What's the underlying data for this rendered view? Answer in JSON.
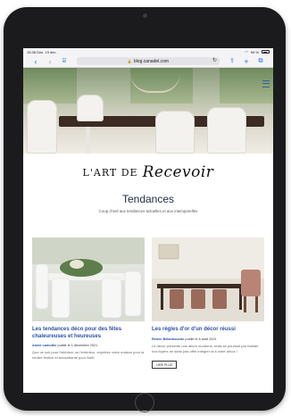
{
  "status": {
    "time": "15:38",
    "date": "Dim. 19 déc.",
    "signal": "59 %"
  },
  "browser": {
    "url": "blog.canadel.com",
    "reload": "↻"
  },
  "logo": {
    "part1": "L'ART DE",
    "part2": "Recevoir"
  },
  "section": {
    "title": "Tendances",
    "subtitle": "Coup d'oeil aux tendances actuelles et aux intemporelles"
  },
  "articles": [
    {
      "title": "Les tendances déco pour des fêtes chaleureuses et heureuses",
      "author": "Annie Lamothe",
      "published": "publié le 1 décembre 2021",
      "excerpt": "Que ce soit pour l'intérieur ou l'extérieur, enjolivez votre maison pour la rendre festive et accueillante pour Noël.",
      "read_more": ""
    },
    {
      "title": "Les règles d'or d'un décor réussi",
      "author": "Renée Bélanhouche",
      "published": "publié le 8 août 2021",
      "excerpt": "Le décor présente une allure moderne, mais se poursuit par habiter nos foyers ne dans pas offrir intégrer là à votre décor !",
      "read_more": "LIRE PLUS"
    }
  ],
  "colors": {
    "accent": "#2b4fa6",
    "browser_blue": "#1a73e8"
  }
}
